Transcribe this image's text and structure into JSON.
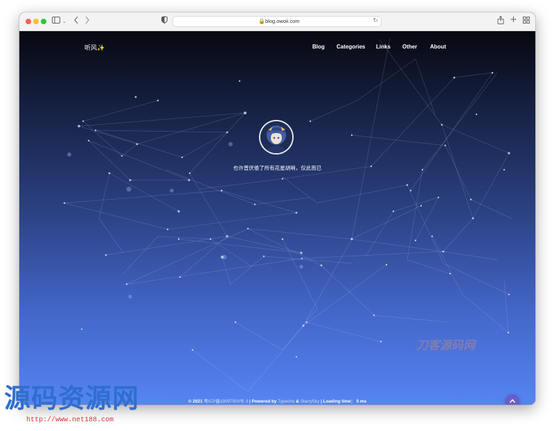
{
  "browser": {
    "url": "blog.owoii.com",
    "icons": {
      "sidebar": "sidebar-icon",
      "back": "back-icon",
      "forward": "forward-icon",
      "shield": "shield-icon",
      "lock": "lock-icon",
      "reload": "reload-icon",
      "share": "share-icon",
      "new_tab": "plus-icon",
      "tabs": "tabs-grid-icon"
    }
  },
  "site": {
    "brand": "听风✨",
    "nav": [
      "Blog",
      "Categories",
      "Links",
      "Other",
      "About"
    ],
    "motto": "也许曾厌倦了所有花星胡哨，仅此而已",
    "footer": {
      "copyright": "© 2021",
      "icp": "粤ICP备19097500号-3",
      "powered_label": "| Powered by",
      "typecho": "Typecho",
      "amp": "&",
      "theme": "StarrySky",
      "loading": "| Loading time： 5 ms"
    },
    "to_top_icon": "chevron-up-icon"
  },
  "watermarks": {
    "center": "刀客源码网",
    "big": "源码资源网",
    "url": "http://www.net188.com"
  },
  "colors": {
    "gradient_top": "#07080f",
    "gradient_bottom": "#5585f2",
    "to_top_button": "#6a5ccc",
    "watermark_blue": "#2f6fcf",
    "watermark_red": "#e03030"
  }
}
